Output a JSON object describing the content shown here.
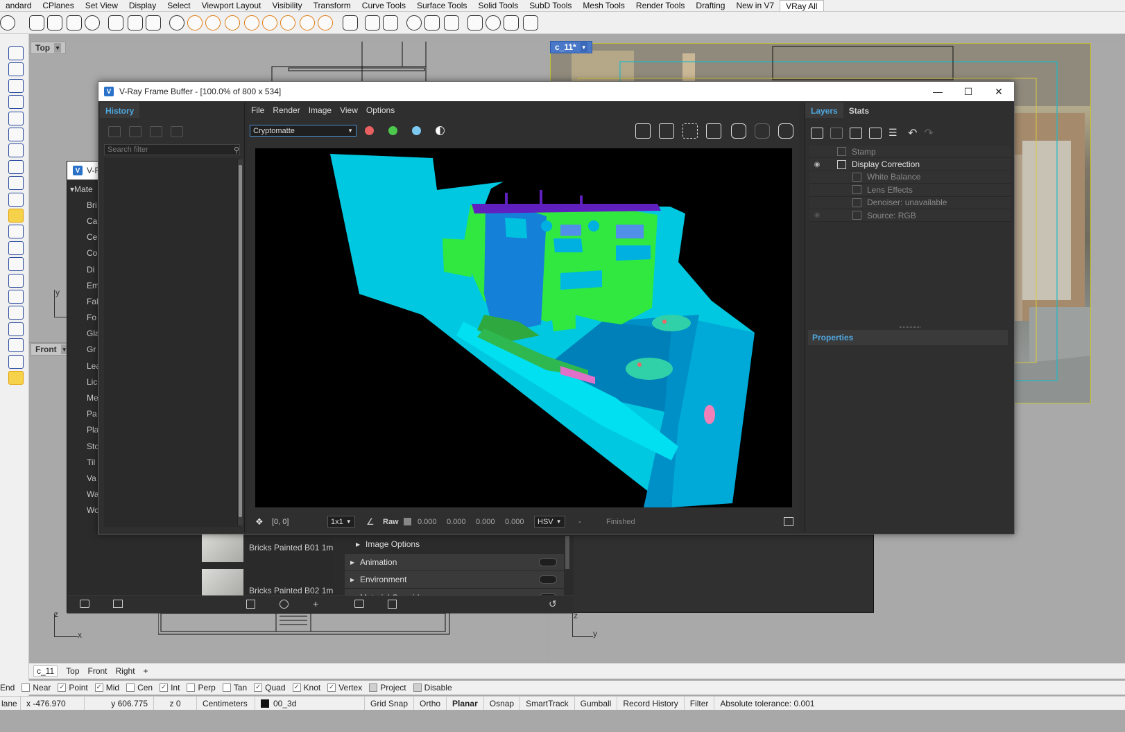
{
  "rhino": {
    "menu_tabs": [
      "andard",
      "CPlanes",
      "Set View",
      "Display",
      "Select",
      "Viewport Layout",
      "Visibility",
      "Transform",
      "Curve Tools",
      "Surface Tools",
      "Solid Tools",
      "SubD Tools",
      "Mesh Tools",
      "Render Tools",
      "Drafting",
      "New in V7",
      "VRay All"
    ],
    "active_tab": "VRay All",
    "viewports": {
      "top_label": "Top",
      "front_label": "Front",
      "camera_label": "c_11*",
      "axis_y": "y",
      "axis_z": "z",
      "axis_x": "x"
    },
    "viewport_tabs": [
      "c_11",
      "Top",
      "Front",
      "Right"
    ],
    "viewport_tab_add": "+",
    "osnaps": [
      {
        "label": "End",
        "checked": true
      },
      {
        "label": "Near",
        "checked": false
      },
      {
        "label": "Point",
        "checked": true
      },
      {
        "label": "Mid",
        "checked": true
      },
      {
        "label": "Cen",
        "checked": false
      },
      {
        "label": "Int",
        "checked": true
      },
      {
        "label": "Perp",
        "checked": false
      },
      {
        "label": "Tan",
        "checked": false
      },
      {
        "label": "Quad",
        "checked": true
      },
      {
        "label": "Knot",
        "checked": true
      },
      {
        "label": "Vertex",
        "checked": true
      },
      {
        "label": "Project",
        "checked": false
      },
      {
        "label": "Disable",
        "checked": false
      }
    ],
    "statusbar": {
      "cplane": "lane",
      "x": "x -476.970",
      "y": "y 606.775",
      "z": "z 0",
      "units": "Centimeters",
      "layer": "00_3d",
      "grid_snap": "Grid Snap",
      "ortho": "Ortho",
      "planar": "Planar",
      "osnap": "Osnap",
      "smarttrack": "SmartTrack",
      "gumball": "Gumball",
      "record_history": "Record History",
      "filter": "Filter",
      "tolerance": "Absolute tolerance: 0.001"
    }
  },
  "asset_editor": {
    "title": "V-R",
    "section": "Mate",
    "materials": [
      "Bri",
      "Ca",
      "Ce",
      "Co",
      "Di",
      "Em",
      "Fal",
      "Fo",
      "Gla",
      "Gr",
      "Lea",
      "Lic",
      "Me",
      "Pa",
      "Pla",
      "Sto",
      "Til",
      "Va",
      "Wa",
      "Wo"
    ],
    "previews": [
      "Bricks Painted B01 1m",
      "Bricks Painted B02 1m"
    ],
    "settings_rows": [
      "Image Options",
      "Animation",
      "Environment",
      "Material Override"
    ]
  },
  "vfb": {
    "title": "V-Ray Frame Buffer - [100.0% of 800 x 534]",
    "history_tab": "History",
    "search_placeholder": "Search filter",
    "menu": [
      "File",
      "Render",
      "Image",
      "View",
      "Options"
    ],
    "channel": "Cryptomatte",
    "layers_tab": "Layers",
    "stats_tab": "Stats",
    "layers": [
      {
        "name": "Stamp",
        "enabled": false,
        "indent": false,
        "visible": false
      },
      {
        "name": "Display Correction",
        "enabled": true,
        "indent": false,
        "visible": true
      },
      {
        "name": "White Balance",
        "enabled": false,
        "indent": true,
        "visible": false
      },
      {
        "name": "Lens Effects",
        "enabled": false,
        "indent": true,
        "visible": false
      },
      {
        "name": "Denoiser: unavailable",
        "enabled": false,
        "indent": true,
        "visible": false
      },
      {
        "name": "Source: RGB",
        "enabled": false,
        "indent": true,
        "visible": true
      }
    ],
    "properties_label": "Properties",
    "status": {
      "coords": "[0, 0]",
      "ratio": "1x1",
      "raw_label": "Raw",
      "values": [
        "0.000",
        "0.000",
        "0.000",
        "0.000"
      ],
      "colorspace": "HSV",
      "dash": "-",
      "state": "Finished"
    },
    "colors": {
      "accent": "#4fa8e0",
      "red_channel": "#e86060",
      "green_channel": "#4cc84c",
      "blue_channel": "#7cc8f0"
    }
  }
}
